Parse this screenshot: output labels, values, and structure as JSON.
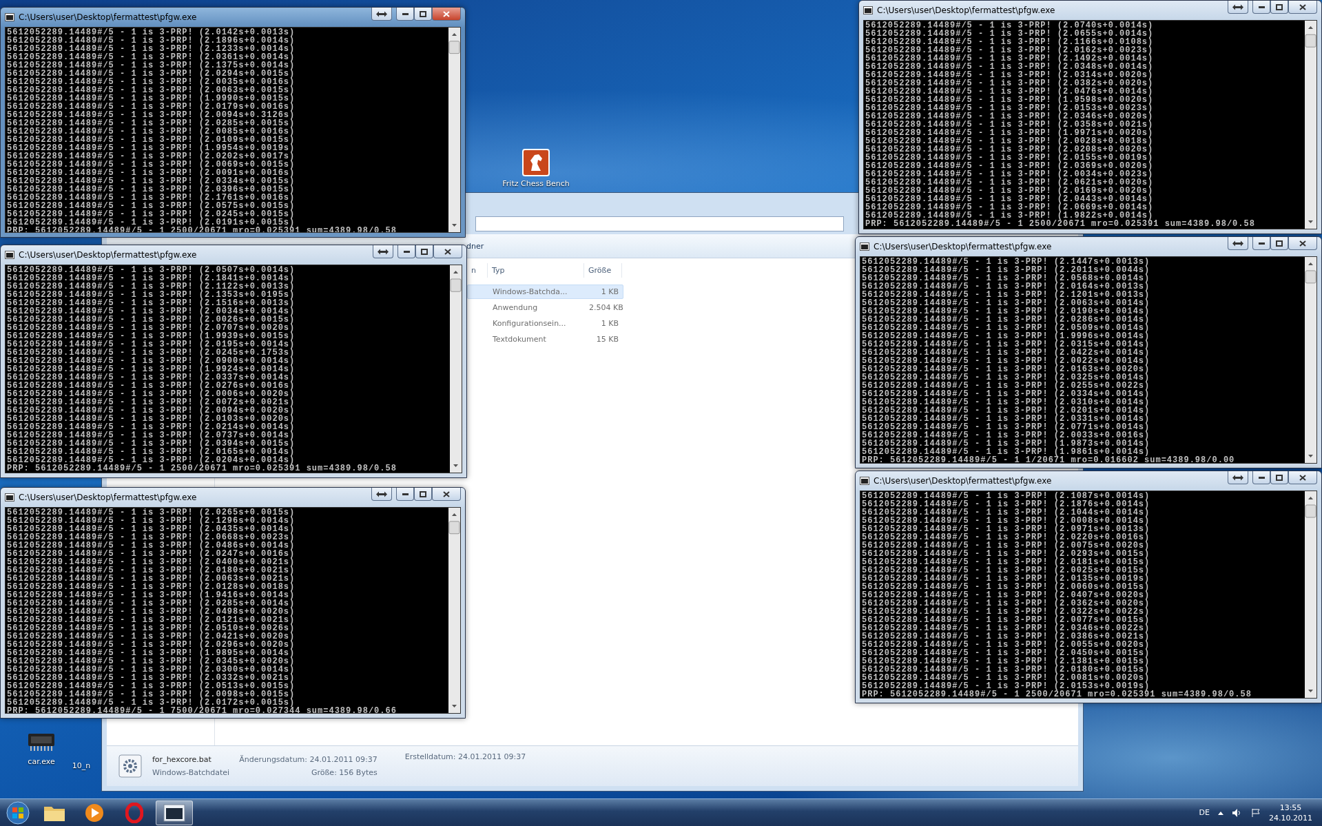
{
  "desktop_icons": [
    {
      "kind": "horse",
      "label": "Fritz Chess Bench"
    },
    {
      "kind": "chip",
      "label": "car.exe"
    },
    {
      "kind": "none",
      "label": "10_n"
    }
  ],
  "explorer": {
    "toolbar_fragment": "dner",
    "columns": [
      "n",
      "Typ",
      "Größe"
    ],
    "rows": [
      {
        "type": "Windows-Batchda...",
        "size": "1 KB",
        "selected": true
      },
      {
        "type": "Anwendung",
        "size": "2.504 KB",
        "selected": false
      },
      {
        "type": "Konfigurationsein...",
        "size": "1 KB",
        "selected": false
      },
      {
        "type": "Textdokument",
        "size": "15 KB",
        "selected": false
      }
    ],
    "details": {
      "name": "for_hexcore.bat",
      "type": "Windows-Batchdatei",
      "modified": "Änderungsdatum: 24.01.2011 09:37",
      "size": "Größe: 156 Bytes",
      "created": "Erstelldatum: 24.01.2011 09:37"
    }
  },
  "consoles": [
    {
      "title": "C:\\Users\\user\\Desktop\\fermattest\\pfgw.exe",
      "active": true,
      "lines": [
        "5612052289.14489#/5 - 1 is 3-PRP! (2.0142s+0.0013s)",
        "5612052289.14489#/5 - 1 is 3-PRP! (2.1896s+0.0014s)",
        "5612052289.14489#/5 - 1 is 3-PRP! (2.1233s+0.0014s)",
        "5612052289.14489#/5 - 1 is 3-PRP! (2.0361s+0.0014s)",
        "5612052289.14489#/5 - 1 is 3-PRP! (2.1375s+0.0014s)",
        "5612052289.14489#/5 - 1 is 3-PRP! (2.0294s+0.0015s)",
        "5612052289.14489#/5 - 1 is 3-PRP! (2.0035s+0.0016s)",
        "5612052289.14489#/5 - 1 is 3-PRP! (2.0063s+0.0015s)",
        "5612052289.14489#/5 - 1 is 3-PRP! (1.9990s+0.0015s)",
        "5612052289.14489#/5 - 1 is 3-PRP! (2.0179s+0.0016s)",
        "5612052289.14489#/5 - 1 is 3-PRP! (2.0094s+0.3126s)",
        "5612052289.14489#/5 - 1 is 3-PRP! (2.0285s+0.0015s)",
        "5612052289.14489#/5 - 1 is 3-PRP! (2.0085s+0.0016s)",
        "5612052289.14489#/5 - 1 is 3-PRP! (2.0109s+0.0015s)",
        "5612052289.14489#/5 - 1 is 3-PRP! (1.9954s+0.0019s)",
        "5612052289.14489#/5 - 1 is 3-PRP! (2.0202s+0.0017s)",
        "5612052289.14489#/5 - 1 is 3-PRP! (2.0069s+0.0015s)",
        "5612052289.14489#/5 - 1 is 3-PRP! (2.0091s+0.0016s)",
        "5612052289.14489#/5 - 1 is 3-PRP! (2.0334s+0.0015s)",
        "5612052289.14489#/5 - 1 is 3-PRP! (2.0396s+0.0015s)",
        "5612052289.14489#/5 - 1 is 3-PRP! (2.1761s+0.0016s)",
        "5612052289.14489#/5 - 1 is 3-PRP! (2.0575s+0.0015s)",
        "5612052289.14489#/5 - 1 is 3-PRP! (2.0245s+0.0015s)",
        "5612052289.14489#/5 - 1 is 3-PRP! (2.0191s+0.0015s)"
      ],
      "status": "PRP: 5612052289.14489#/5 - 1 2500/20671 mro=0.025391 sum=4389.98/0.58"
    },
    {
      "title": "C:\\Users\\user\\Desktop\\fermattest\\pfgw.exe",
      "active": false,
      "lines": [
        "5612052289.14489#/5 - 1 is 3-PRP! (2.0740s+0.0014s)",
        "5612052289.14489#/5 - 1 is 3-PRP! (2.0655s+0.0014s)",
        "5612052289.14489#/5 - 1 is 3-PRP! (2.1166s+0.0108s)",
        "5612052289.14489#/5 - 1 is 3-PRP! (2.0162s+0.0023s)",
        "5612052289.14489#/5 - 1 is 3-PRP! (2.1492s+0.0014s)",
        "5612052289.14489#/5 - 1 is 3-PRP! (2.0348s+0.0014s)",
        "5612052289.14489#/5 - 1 is 3-PRP! (2.0314s+0.0020s)",
        "5612052289.14489#/5 - 1 is 3-PRP! (2.0382s+0.0020s)",
        "5612052289.14489#/5 - 1 is 3-PRP! (2.0476s+0.0014s)",
        "5612052289.14489#/5 - 1 is 3-PRP! (1.9598s+0.0020s)",
        "5612052289.14489#/5 - 1 is 3-PRP! (2.0153s+0.0023s)",
        "5612052289.14489#/5 - 1 is 3-PRP! (2.0346s+0.0020s)",
        "5612052289.14489#/5 - 1 is 3-PRP! (2.0358s+0.0021s)",
        "5612052289.14489#/5 - 1 is 3-PRP! (1.9971s+0.0020s)",
        "5612052289.14489#/5 - 1 is 3-PRP! (2.0028s+0.0018s)",
        "5612052289.14489#/5 - 1 is 3-PRP! (2.0208s+0.0020s)",
        "5612052289.14489#/5 - 1 is 3-PRP! (2.0155s+0.0019s)",
        "5612052289.14489#/5 - 1 is 3-PRP! (2.0369s+0.0020s)",
        "5612052289.14489#/5 - 1 is 3-PRP! (2.0034s+0.0023s)",
        "5612052289.14489#/5 - 1 is 3-PRP! (2.0621s+0.0020s)",
        "5612052289.14489#/5 - 1 is 3-PRP! (2.0169s+0.0020s)",
        "5612052289.14489#/5 - 1 is 3-PRP! (2.0443s+0.0014s)",
        "5612052289.14489#/5 - 1 is 3-PRP! (2.0669s+0.0014s)",
        "5612052289.14489#/5 - 1 is 3-PRP! (1.9822s+0.0014s)"
      ],
      "status": "PRP: 5612052289.14489#/5 - 1 2500/20671 mro=0.025391 sum=4389.98/0.58"
    },
    {
      "title": "C:\\Users\\user\\Desktop\\fermattest\\pfgw.exe",
      "active": false,
      "lines": [
        "5612052289.14489#/5 - 1 is 3-PRP! (2.0507s+0.0014s)",
        "5612052289.14489#/5 - 1 is 3-PRP! (2.1841s+0.0014s)",
        "5612052289.14489#/5 - 1 is 3-PRP! (2.1122s+0.0013s)",
        "5612052289.14489#/5 - 1 is 3-PRP! (2.1353s+0.0195s)",
        "5612052289.14489#/5 - 1 is 3-PRP! (2.1516s+0.0013s)",
        "5612052289.14489#/5 - 1 is 3-PRP! (2.0034s+0.0014s)",
        "5612052289.14489#/5 - 1 is 3-PRP! (2.0026s+0.0015s)",
        "5612052289.14489#/5 - 1 is 3-PRP! (2.0707s+0.0020s)",
        "5612052289.14489#/5 - 1 is 3-PRP! (1.9939s+0.0015s)",
        "5612052289.14489#/5 - 1 is 3-PRP! (2.0195s+0.0014s)",
        "5612052289.14489#/5 - 1 is 3-PRP! (2.0245s+0.1753s)",
        "5612052289.14489#/5 - 1 is 3-PRP! (2.0900s+0.0014s)",
        "5612052289.14489#/5 - 1 is 3-PRP! (1.9924s+0.0014s)",
        "5612052289.14489#/5 - 1 is 3-PRP! (2.0337s+0.0014s)",
        "5612052289.14489#/5 - 1 is 3-PRP! (2.0276s+0.0016s)",
        "5612052289.14489#/5 - 1 is 3-PRP! (2.0006s+0.0020s)",
        "5612052289.14489#/5 - 1 is 3-PRP! (2.0072s+0.0021s)",
        "5612052289.14489#/5 - 1 is 3-PRP! (2.0094s+0.0020s)",
        "5612052289.14489#/5 - 1 is 3-PRP! (2.0103s+0.0020s)",
        "5612052289.14489#/5 - 1 is 3-PRP! (2.0214s+0.0014s)",
        "5612052289.14489#/5 - 1 is 3-PRP! (2.0737s+0.0014s)",
        "5612052289.14489#/5 - 1 is 3-PRP! (2.0394s+0.0015s)",
        "5612052289.14489#/5 - 1 is 3-PRP! (2.0165s+0.0014s)",
        "5612052289.14489#/5 - 1 is 3-PRP! (2.0204s+0.0014s)"
      ],
      "status": "PRP: 5612052289.14489#/5 - 1 2500/20671 mro=0.025391 sum=4389.98/0.58"
    },
    {
      "title": "C:\\Users\\user\\Desktop\\fermattest\\pfgw.exe",
      "active": false,
      "lines": [
        "5612052289.14489#/5 - 1 is 3-PRP! (2.1447s+0.0013s)",
        "5612052289.14489#/5 - 1 is 3-PRP! (2.2011s+0.0044s)",
        "5612052289.14489#/5 - 1 is 3-PRP! (2.0568s+0.0014s)",
        "5612052289.14489#/5 - 1 is 3-PRP! (2.0164s+0.0013s)",
        "5612052289.14489#/5 - 1 is 3-PRP! (2.1201s+0.0013s)",
        "5612052289.14489#/5 - 1 is 3-PRP! (2.0063s+0.0014s)",
        "5612052289.14489#/5 - 1 is 3-PRP! (2.0190s+0.0014s)",
        "5612052289.14489#/5 - 1 is 3-PRP! (2.0286s+0.0014s)",
        "5612052289.14489#/5 - 1 is 3-PRP! (2.0509s+0.0014s)",
        "5612052289.14489#/5 - 1 is 3-PRP! (1.9996s+0.0014s)",
        "5612052289.14489#/5 - 1 is 3-PRP! (2.0315s+0.0014s)",
        "5612052289.14489#/5 - 1 is 3-PRP! (2.0422s+0.0014s)",
        "5612052289.14489#/5 - 1 is 3-PRP! (2.0022s+0.0014s)",
        "5612052289.14489#/5 - 1 is 3-PRP! (2.0163s+0.0020s)",
        "5612052289.14489#/5 - 1 is 3-PRP! (2.0325s+0.0014s)",
        "5612052289.14489#/5 - 1 is 3-PRP! (2.0255s+0.0022s)",
        "5612052289.14489#/5 - 1 is 3-PRP! (2.0334s+0.0014s)",
        "5612052289.14489#/5 - 1 is 3-PRP! (2.0310s+0.0014s)",
        "5612052289.14489#/5 - 1 is 3-PRP! (2.0201s+0.0014s)",
        "5612052289.14489#/5 - 1 is 3-PRP! (2.0331s+0.0014s)",
        "5612052289.14489#/5 - 1 is 3-PRP! (2.0771s+0.0014s)",
        "5612052289.14489#/5 - 1 is 3-PRP! (2.0033s+0.0016s)",
        "5612052289.14489#/5 - 1 is 3-PRP! (1.9873s+0.0014s)",
        "5612052289.14489#/5 - 1 is 3-PRP! (1.9861s+0.0014s)"
      ],
      "status": "PRP: 5612052289.14489#/5 - 1 1/20671 mro=0.016602 sum=4389.98/0.00"
    },
    {
      "title": "C:\\Users\\user\\Desktop\\fermattest\\pfgw.exe",
      "active": false,
      "lines": [
        "5612052289.14489#/5 - 1 is 3-PRP! (2.0265s+0.0015s)",
        "5612052289.14489#/5 - 1 is 3-PRP! (2.1296s+0.0014s)",
        "5612052289.14489#/5 - 1 is 3-PRP! (2.0435s+0.0014s)",
        "5612052289.14489#/5 - 1 is 3-PRP! (2.0668s+0.0023s)",
        "5612052289.14489#/5 - 1 is 3-PRP! (2.0486s+0.0014s)",
        "5612052289.14489#/5 - 1 is 3-PRP! (2.0247s+0.0016s)",
        "5612052289.14489#/5 - 1 is 3-PRP! (2.0400s+0.0021s)",
        "5612052289.14489#/5 - 1 is 3-PRP! (2.0180s+0.0021s)",
        "5612052289.14489#/5 - 1 is 3-PRP! (2.0063s+0.0021s)",
        "5612052289.14489#/5 - 1 is 3-PRP! (2.0128s+0.0018s)",
        "5612052289.14489#/5 - 1 is 3-PRP! (1.9416s+0.0014s)",
        "5612052289.14489#/5 - 1 is 3-PRP! (2.0285s+0.0014s)",
        "5612052289.14489#/5 - 1 is 3-PRP! (2.0498s+0.0020s)",
        "5612052289.14489#/5 - 1 is 3-PRP! (2.0121s+0.0021s)",
        "5612052289.14489#/5 - 1 is 3-PRP! (2.0510s+0.0026s)",
        "5612052289.14489#/5 - 1 is 3-PRP! (2.0421s+0.0020s)",
        "5612052289.14489#/5 - 1 is 3-PRP! (2.0296s+0.0020s)",
        "5612052289.14489#/5 - 1 is 3-PRP! (1.9895s+0.0014s)",
        "5612052289.14489#/5 - 1 is 3-PRP! (2.0345s+0.0020s)",
        "5612052289.14489#/5 - 1 is 3-PRP! (2.0300s+0.0014s)",
        "5612052289.14489#/5 - 1 is 3-PRP! (2.0332s+0.0021s)",
        "5612052289.14489#/5 - 1 is 3-PRP! (2.0513s+0.0015s)",
        "5612052289.14489#/5 - 1 is 3-PRP! (2.0098s+0.0015s)",
        "5612052289.14489#/5 - 1 is 3-PRP! (2.0172s+0.0015s)"
      ],
      "status": "PRP: 5612052289.14489#/5 - 1 7500/20671 mro=0.027344 sum=4389.98/0.66"
    },
    {
      "title": "C:\\Users\\user\\Desktop\\fermattest\\pfgw.exe",
      "active": false,
      "lines": [
        "5612052289.14489#/5 - 1 is 3-PRP! (2.1087s+0.0014s)",
        "5612052289.14489#/5 - 1 is 3-PRP! (2.1876s+0.0014s)",
        "5612052289.14489#/5 - 1 is 3-PRP! (2.1044s+0.0014s)",
        "5612052289.14489#/5 - 1 is 3-PRP! (2.0008s+0.0014s)",
        "5612052289.14489#/5 - 1 is 3-PRP! (2.0971s+0.0013s)",
        "5612052289.14489#/5 - 1 is 3-PRP! (2.0220s+0.0016s)",
        "5612052289.14489#/5 - 1 is 3-PRP! (2.0075s+0.0020s)",
        "5612052289.14489#/5 - 1 is 3-PRP! (2.0293s+0.0015s)",
        "5612052289.14489#/5 - 1 is 3-PRP! (2.0181s+0.0015s)",
        "5612052289.14489#/5 - 1 is 3-PRP! (2.0025s+0.0015s)",
        "5612052289.14489#/5 - 1 is 3-PRP! (2.0135s+0.0019s)",
        "5612052289.14489#/5 - 1 is 3-PRP! (2.0060s+0.0015s)",
        "5612052289.14489#/5 - 1 is 3-PRP! (2.0407s+0.0020s)",
        "5612052289.14489#/5 - 1 is 3-PRP! (2.0362s+0.0020s)",
        "5612052289.14489#/5 - 1 is 3-PRP! (2.0322s+0.0022s)",
        "5612052289.14489#/5 - 1 is 3-PRP! (2.0077s+0.0015s)",
        "5612052289.14489#/5 - 1 is 3-PRP! (2.0346s+0.0022s)",
        "5612052289.14489#/5 - 1 is 3-PRP! (2.0386s+0.0021s)",
        "5612052289.14489#/5 - 1 is 3-PRP! (2.0055s+0.0020s)",
        "5612052289.14489#/5 - 1 is 3-PRP! (2.0450s+0.0015s)",
        "5612052289.14489#/5 - 1 is 3-PRP! (2.1381s+0.0015s)",
        "5612052289.14489#/5 - 1 is 3-PRP! (2.0180s+0.0015s)",
        "5612052289.14489#/5 - 1 is 3-PRP! (2.0081s+0.0020s)",
        "5612052289.14489#/5 - 1 is 3-PRP! (2.0153s+0.0019s)"
      ],
      "status": "PRP: 5612052289.14489#/5 - 1 2500/20671 mro=0.025391 sum=4389.98/0.58"
    }
  ],
  "taskbar": {
    "items": [
      {
        "kind": "start",
        "selected": false
      },
      {
        "kind": "folder",
        "selected": false
      },
      {
        "kind": "media",
        "selected": false
      },
      {
        "kind": "browser",
        "selected": false
      },
      {
        "kind": "console",
        "selected": true
      }
    ],
    "tray": {
      "language": "DE",
      "time": "13:55",
      "date": "24.10.2011"
    }
  }
}
